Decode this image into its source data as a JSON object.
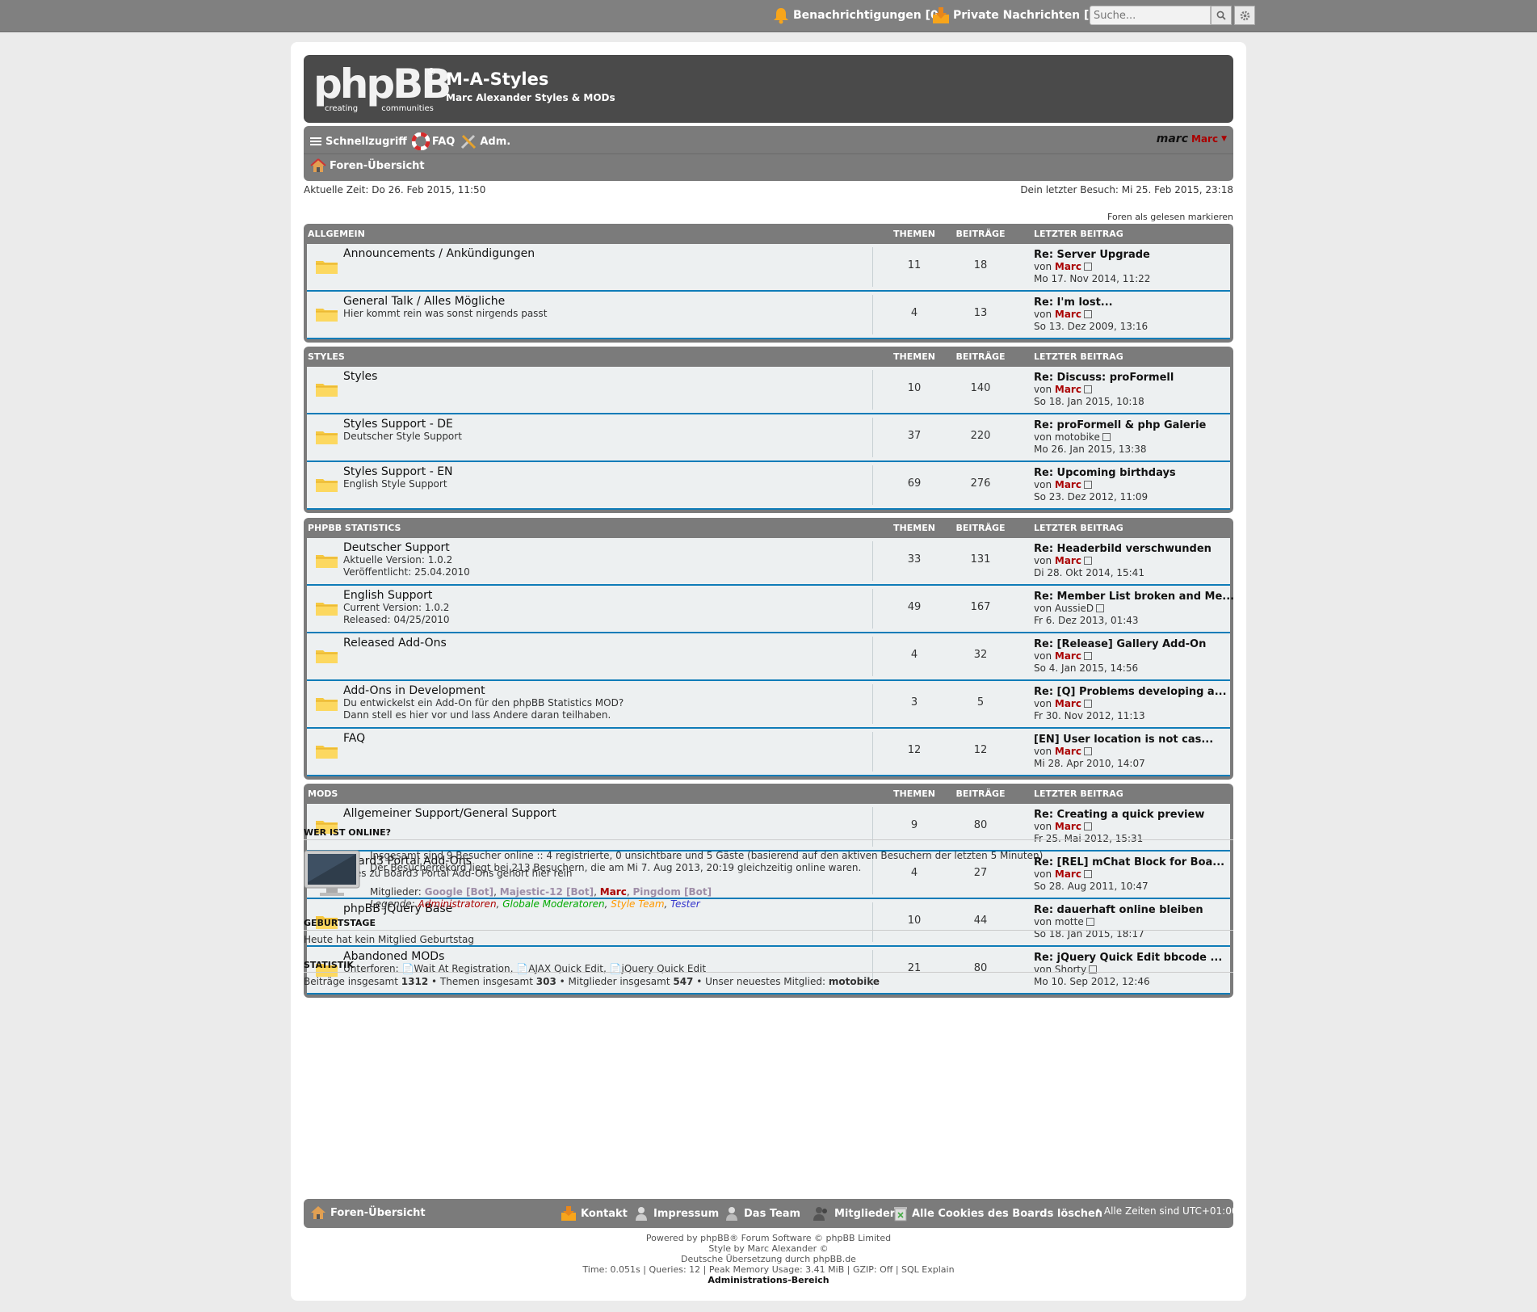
{
  "topbar": {
    "notifications": "Benachrichtigungen [0]",
    "messages": "Private Nachrichten [0]",
    "search_placeholder": "Suche..."
  },
  "header": {
    "logo_text": "phpBB",
    "logo_reg": "®",
    "logo_sub": "creating communities",
    "site_title": "M-A-Styles",
    "site_desc": "Marc Alexander Styles & MODs"
  },
  "nav": {
    "quick_access": "Schnellzugriff",
    "faq": "FAQ",
    "acp": "Adm.",
    "username": "Marc",
    "avatar_text": "marc",
    "breadcrumb": "Foren-Übersicht"
  },
  "info": {
    "current_time": "Aktuelle Zeit: Do 26. Feb 2015, 11:50",
    "last_visit": "Dein letzter Besuch: Mi 25. Feb 2015, 23:18",
    "mark_read": "Foren als gelesen markieren"
  },
  "columns": {
    "topics": "THEMEN",
    "posts": "BEITRÄGE",
    "last": "LETZTER BEITRAG"
  },
  "categories": [
    {
      "name": "ALLGEMEIN",
      "forums": [
        {
          "title": "Announcements / Ankündigungen",
          "desc": [],
          "topics": "11",
          "posts": "18",
          "last_title": "Re: Server Upgrade",
          "last_user": "Marc",
          "last_red": true,
          "last_date": "Mo 17. Nov 2014, 11:22"
        },
        {
          "title": "General Talk / Alles Mögliche",
          "desc": [
            "Hier kommt rein was sonst nirgends passt"
          ],
          "topics": "4",
          "posts": "13",
          "last_title": "Re: I'm lost...",
          "last_user": "Marc",
          "last_red": true,
          "last_date": "So 13. Dez 2009, 13:16"
        }
      ]
    },
    {
      "name": "STYLES",
      "forums": [
        {
          "title": "Styles",
          "desc": [],
          "topics": "10",
          "posts": "140",
          "last_title": "Re: Discuss: proFormell",
          "last_user": "Marc",
          "last_red": true,
          "last_date": "So 18. Jan 2015, 10:18"
        },
        {
          "title": "Styles Support - DE",
          "desc": [
            "Deutscher Style Support"
          ],
          "topics": "37",
          "posts": "220",
          "last_title": "Re: proFormell & php Galerie",
          "last_user": "motobike",
          "last_red": false,
          "last_date": "Mo 26. Jan 2015, 13:38"
        },
        {
          "title": "Styles Support - EN",
          "desc": [
            "English Style Support"
          ],
          "topics": "69",
          "posts": "276",
          "last_title": "Re: Upcoming birthdays",
          "last_user": "Marc",
          "last_red": true,
          "last_date": "So 23. Dez 2012, 11:09"
        }
      ]
    },
    {
      "name": "PHPBB STATISTICS",
      "forums": [
        {
          "title": "Deutscher Support",
          "desc": [
            "Aktuelle Version: 1.0.2",
            "Veröffentlicht: 25.04.2010"
          ],
          "topics": "33",
          "posts": "131",
          "last_title": "Re: Headerbild verschwunden",
          "last_user": "Marc",
          "last_red": true,
          "last_date": "Di 28. Okt 2014, 15:41"
        },
        {
          "title": "English Support",
          "desc": [
            "Current Version: 1.0.2",
            "Released: 04/25/2010"
          ],
          "topics": "49",
          "posts": "167",
          "last_title": "Re: Member List broken and Me...",
          "last_user": "AussieD",
          "last_red": false,
          "last_date": "Fr 6. Dez 2013, 01:43"
        },
        {
          "title": "Released Add-Ons",
          "desc": [],
          "topics": "4",
          "posts": "32",
          "last_title": "Re: [Release] Gallery Add-On",
          "last_user": "Marc",
          "last_red": true,
          "last_date": "So 4. Jan 2015, 14:56"
        },
        {
          "title": "Add-Ons in Development",
          "desc": [
            "Du entwickelst ein Add-On für den phpBB Statistics MOD?",
            "Dann stell es hier vor und lass Andere daran teilhaben."
          ],
          "topics": "3",
          "posts": "5",
          "last_title": "Re: [Q] Problems developing a...",
          "last_user": "Marc",
          "last_red": true,
          "last_date": "Fr 30. Nov 2012, 11:13"
        },
        {
          "title": "FAQ",
          "desc": [],
          "topics": "12",
          "posts": "12",
          "last_title": "[EN] User location is not cas...",
          "last_user": "Marc",
          "last_red": true,
          "last_date": "Mi 28. Apr 2010, 14:07"
        }
      ]
    },
    {
      "name": "MODS",
      "forums": [
        {
          "title": "Allgemeiner Support/General Support",
          "desc": [],
          "topics": "9",
          "posts": "80",
          "last_title": "Re: Creating a quick preview",
          "last_user": "Marc",
          "last_red": true,
          "last_date": "Fr 25. Mai 2012, 15:31"
        },
        {
          "title": "Board3 Portal Add-Ons",
          "desc": [
            "Alles zu Board3 Portal Add-Ons gehört hier rein"
          ],
          "topics": "4",
          "posts": "27",
          "last_title": "Re: [REL] mChat Block for Boa...",
          "last_user": "Marc",
          "last_red": true,
          "last_date": "So 28. Aug 2011, 10:47"
        },
        {
          "title": "phpBB jQuery Base",
          "desc": [],
          "topics": "10",
          "posts": "44",
          "last_title": "Re: dauerhaft online bleiben",
          "last_user": "motte",
          "last_red": false,
          "last_date": "So 18. Jan 2015, 18:17"
        },
        {
          "title": "Abandoned MODs",
          "desc": [
            "Unterforen: 📄Wait At Registration, 📄AJAX Quick Edit, 📄jQuery Quick Edit"
          ],
          "topics": "21",
          "posts": "80",
          "last_title": "Re: jQuery Quick Edit bbcode ...",
          "last_user": "Shorty",
          "last_red": false,
          "last_date": "Mo 10. Sep 2012, 12:46"
        }
      ]
    }
  ],
  "last_prefix": "von",
  "online": {
    "title": "WER IST ONLINE?",
    "line1": "Insgesamt sind 9 Besucher online :: 4 registrierte, 0 unsichtbare und 5 Gäste (basierend auf den aktiven Besuchern der letzten 5 Minuten)",
    "line2": "Der Besucherrekord liegt bei 213 Besuchern, die am Mi 7. Aug 2013, 20:19 gleichzeitig online waren.",
    "members_label": "Mitglieder:",
    "members": [
      {
        "name": "Google [Bot]",
        "color": "#9e8da7"
      },
      {
        "name": "Majestic-12 [Bot]",
        "color": "#9e8da7"
      },
      {
        "name": "Marc",
        "color": "#aa0000"
      },
      {
        "name": "Pingdom [Bot]",
        "color": "#9e8da7"
      }
    ],
    "legend_label": "Legende:",
    "legend": [
      {
        "name": "Administratoren",
        "color": "#aa0000"
      },
      {
        "name": "Globale Moderatoren",
        "color": "#00aa00"
      },
      {
        "name": "Style Team",
        "color": "#ff9900"
      },
      {
        "name": "Tester",
        "color": "#3333cc"
      }
    ]
  },
  "birthdays": {
    "title": "GEBURTSTAGE",
    "text": "Heute hat kein Mitglied Geburtstag"
  },
  "stats": {
    "title": "STATISTIK",
    "posts_label": "Beiträge insgesamt",
    "posts": "1312",
    "topics_label": "Themen insgesamt",
    "topics": "303",
    "members_label": "Mitglieder insgesamt",
    "members": "547",
    "newest_label": "Unser neuestes Mitglied:",
    "newest": "motobike"
  },
  "footer": {
    "index": "Foren-Übersicht",
    "contact": "Kontakt",
    "impressum": "Impressum",
    "team": "Das Team",
    "members": "Mitglieder",
    "cookies": "Alle Cookies des Boards löschen",
    "timezone": "• Alle Zeiten sind UTC+01:00"
  },
  "credits": {
    "line1": "Powered by phpBB® Forum Software © phpBB Limited",
    "line2": "Style by Marc Alexander ©",
    "line3": "Deutsche Übersetzung durch phpBB.de",
    "line4": "Time: 0.051s | Queries: 12 | Peak Memory Usage: 3.41 MiB | GZIP: Off | SQL Explain",
    "line5": "Administrations-Bereich"
  },
  "colors": {
    "accent": "#0f7cb8",
    "bar": "#7b7b7b",
    "header": "#4a4a4a",
    "admin": "#aa0000"
  }
}
